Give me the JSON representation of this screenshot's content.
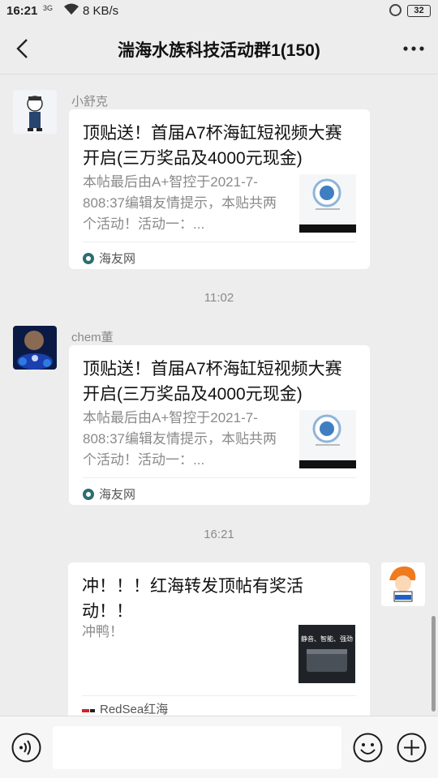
{
  "status_bar": {
    "time": "16:21",
    "signal": "3G",
    "speed": "8 KB/s",
    "battery": "32"
  },
  "header": {
    "title": "湍海水族科技活动群1(150)",
    "back_icon": "back-arrow-icon",
    "more_icon": "more-dots-icon"
  },
  "messages": [
    {
      "sender": "小舒克",
      "title": "顶贴送！首届A7杯海缸短视频大赛开启(三万奖品及4000元现金)",
      "desc": "本帖最后由A+智控于2021-7-808:37编辑友情提示，本贴共两个活动！活动一：...",
      "source": "海友网"
    },
    {
      "time": "11:02"
    },
    {
      "sender": "chem董",
      "title": "顶贴送！首届A7杯海缸短视频大赛开启(三万奖品及4000元现金)",
      "desc": "本帖最后由A+智控于2021-7-808:37编辑友情提示，本贴共两个活动！活动一：...",
      "source": "海友网"
    },
    {
      "time": "16:21"
    },
    {
      "title": "冲！！！红海转发顶帖有奖活动！！",
      "desc": "冲鸭！",
      "thumb_caption": "静音、智能、强劲",
      "source": "RedSea红海"
    }
  ],
  "colors": {
    "background": "#ededed",
    "card": "#ffffff",
    "muted_text": "#8a8a8a"
  }
}
